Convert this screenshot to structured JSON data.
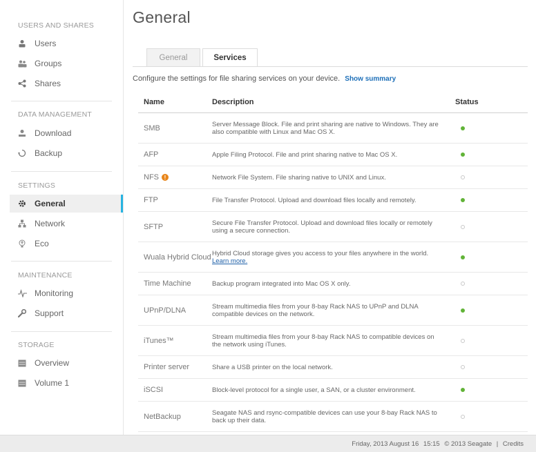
{
  "sidebar": {
    "sections": [
      {
        "title": "USERS AND SHARES"
      },
      {
        "title": "DATA MANAGEMENT"
      },
      {
        "title": "SETTINGS"
      },
      {
        "title": "MAINTENANCE"
      },
      {
        "title": "STORAGE"
      }
    ],
    "items": {
      "users": {
        "label": "Users",
        "icon": "user-icon"
      },
      "groups": {
        "label": "Groups",
        "icon": "group-icon"
      },
      "shares": {
        "label": "Shares",
        "icon": "share-icon"
      },
      "download": {
        "label": "Download",
        "icon": "download-icon"
      },
      "backup": {
        "label": "Backup",
        "icon": "backup-icon"
      },
      "general": {
        "label": "General",
        "icon": "gear-icon",
        "active": true
      },
      "network": {
        "label": "Network",
        "icon": "network-icon"
      },
      "eco": {
        "label": "Eco",
        "icon": "eco-icon"
      },
      "monitoring": {
        "label": "Monitoring",
        "icon": "pulse-icon"
      },
      "support": {
        "label": "Support",
        "icon": "wrench-icon"
      },
      "overview": {
        "label": "Overview",
        "icon": "storage-icon"
      },
      "volume1": {
        "label": "Volume 1",
        "icon": "volume-icon"
      }
    }
  },
  "header": {
    "title": "General"
  },
  "tabs": [
    {
      "label": "General",
      "active": false
    },
    {
      "label": "Services",
      "active": true
    }
  ],
  "intro": {
    "text": "Configure the settings for file sharing services on your device.",
    "link": "Show summary"
  },
  "table": {
    "columns": {
      "name": "Name",
      "description": "Description",
      "status": "Status"
    },
    "rows": [
      {
        "name": "SMB",
        "description": "Server Message Block. File and print sharing are native to Windows. They are also compatible with Linux and Mac OS X.",
        "enabled": true
      },
      {
        "name": "AFP",
        "description": "Apple Filing Protocol. File and print sharing native to Mac OS X.",
        "enabled": true
      },
      {
        "name": "NFS",
        "warning": "!",
        "description": "Network File System. File sharing native to UNIX and Linux.",
        "enabled": false
      },
      {
        "name": "FTP",
        "description": "File Transfer Protocol. Upload and download files locally and remotely.",
        "enabled": true
      },
      {
        "name": "SFTP",
        "description": "Secure File Transfer Protocol. Upload and download files locally or remotely using a secure connection.",
        "enabled": false
      },
      {
        "name": "Wuala Hybrid Cloud",
        "description": "Hybrid Cloud storage gives you access to your files anywhere in the world.",
        "link": "Learn more.",
        "enabled": true
      },
      {
        "name": "Time Machine",
        "description": "Backup program integrated into Mac OS X only.",
        "enabled": false
      },
      {
        "name": "UPnP/DLNA",
        "description": "Stream multimedia files from your 8-bay Rack NAS to UPnP and DLNA compatible devices on the network.",
        "enabled": true
      },
      {
        "name": "iTunes™",
        "description": "Stream multimedia files from your 8-bay Rack NAS to compatible devices on the network using iTunes.",
        "enabled": false
      },
      {
        "name": "Printer server",
        "description": "Share a USB printer on the local network.",
        "enabled": false
      },
      {
        "name": "iSCSI",
        "description": "Block-level protocol for a single user, a SAN, or a cluster environment.",
        "enabled": true
      },
      {
        "name": "NetBackup",
        "description": "Seagate NAS and rsync-compatible devices can use your 8-bay Rack NAS to back up their data.",
        "enabled": false
      }
    ]
  },
  "footer": {
    "datetime": "Friday, 2013 August 16",
    "time": "15:15",
    "copyright": "© 2013 Seagate",
    "separator": "|",
    "credits": "Credits"
  },
  "colors": {
    "accent": "#27b3e1",
    "status_on": "#61b337",
    "link": "#1d6fb8",
    "warning": "#e8851a"
  }
}
